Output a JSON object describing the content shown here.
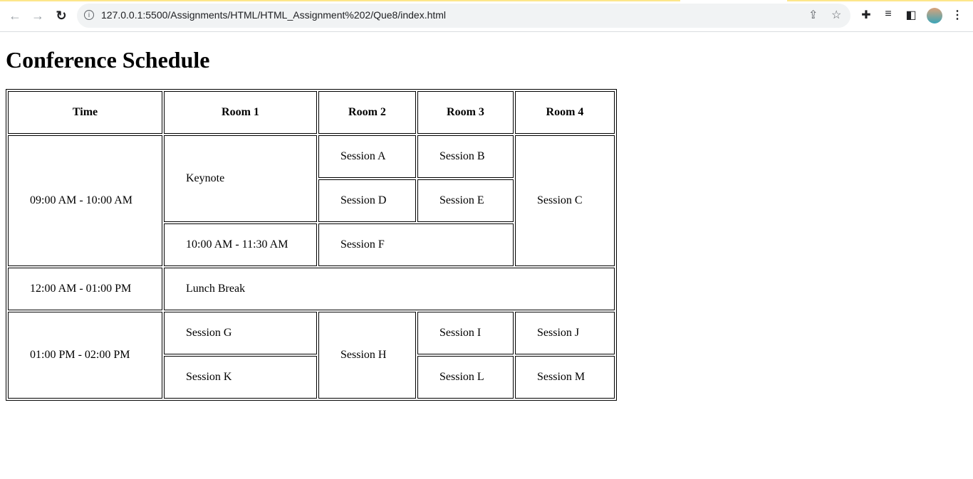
{
  "browser": {
    "url": "127.0.0.1:5500/Assignments/HTML/HTML_Assignment%202/Que8/index.html",
    "icons": [
      "back-icon",
      "forward-icon",
      "reload-icon",
      "info-icon",
      "share-icon",
      "star-icon",
      "extensions-icon",
      "media-icon",
      "side-panel-icon",
      "avatar",
      "menu-icon"
    ]
  },
  "page": {
    "title": "Conference Schedule",
    "headers": [
      "Time",
      "Room 1",
      "Room 2",
      "Room 3",
      "Room 4"
    ],
    "rows": {
      "t1": "09:00 AM - 10:00 AM",
      "keynote": "Keynote",
      "a": "Session A",
      "b": "Session B",
      "c": "Session C",
      "d": "Session D",
      "e": "Session E",
      "t2": "10:00 AM - 11:30 AM",
      "f": "Session F",
      "t3": "12:00 AM - 01:00 PM",
      "lunch": "Lunch Break",
      "t4": "01:00 PM - 02:00 PM",
      "g": "Session G",
      "h": "Session H",
      "i": "Session I",
      "j": "Session J",
      "k": "Session K",
      "l": "Session L",
      "m": "Session M"
    }
  }
}
